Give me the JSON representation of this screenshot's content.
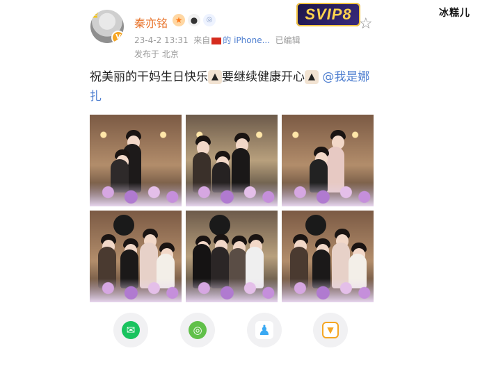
{
  "post": {
    "username": "秦亦铭",
    "svip_badge": "SVIP8",
    "timestamp": "23-4-2 13:31",
    "source_prefix": "来自",
    "source_device": "的 iPhone...",
    "edited": "已编辑",
    "location": "发布于 北京",
    "text_main": "祝美丽的干妈生日快乐",
    "text_mid": "要继续健康开心",
    "mention": "@我是娜扎"
  },
  "icons": {
    "crown": "crown-icon",
    "verified": "verified-badge-icon",
    "fire": "fire-badge-icon",
    "panda": "panda-badge-icon",
    "ring": "ring-badge-icon",
    "star": "star-icon",
    "cake": "birthday-cake-emoji"
  },
  "share": {
    "items": [
      {
        "name": "wechat",
        "color": "#19c35e"
      },
      {
        "name": "moments",
        "color": "#61c04a"
      },
      {
        "name": "qq",
        "color": "#3aa9f3"
      },
      {
        "name": "save-image",
        "color": "#f5a623"
      }
    ]
  },
  "watermark": "冰糕儿",
  "colors": {
    "username": "#e8732a",
    "link": "#4f7fd0",
    "meta": "#9a9a9a"
  }
}
